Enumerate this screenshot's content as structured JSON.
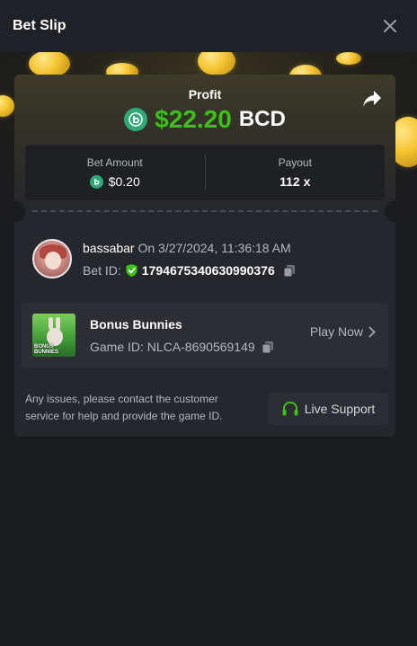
{
  "header": {
    "title": "Bet Slip"
  },
  "profit": {
    "label": "Profit",
    "amount": "$22.20",
    "currency": "BCD"
  },
  "stats": {
    "bet_amount_label": "Bet Amount",
    "bet_amount_value": "$0.20",
    "payout_label": "Payout",
    "payout_value": "112 x"
  },
  "user": {
    "name": "bassabar",
    "timestamp": "On 3/27/2024, 11:36:18 AM",
    "bet_id_label": "Bet ID:",
    "bet_id": "1794675340630990376"
  },
  "game": {
    "name": "Bonus Bunnies",
    "game_id": "Game ID: NLCA-8690569149",
    "thumb_label_1": "BONUS",
    "thumb_label_2": "BUNNIES",
    "play_label": "Play Now"
  },
  "support": {
    "text": "Any issues, please contact the customer service for help and provide the game ID.",
    "button_label": "Live Support"
  },
  "colors": {
    "profit_green": "#3bc117",
    "bcd_coin": "#2fa878",
    "background": "#1b1c20",
    "card": "#26272c",
    "muted_text": "#b4b7bd"
  },
  "icons": {
    "close": "close-icon",
    "share": "share-icon",
    "bcd": "bcd-coin-icon",
    "shield": "shield-check-icon",
    "copy": "copy-icon",
    "chevron": "chevron-right-icon",
    "headset": "headset-icon"
  }
}
